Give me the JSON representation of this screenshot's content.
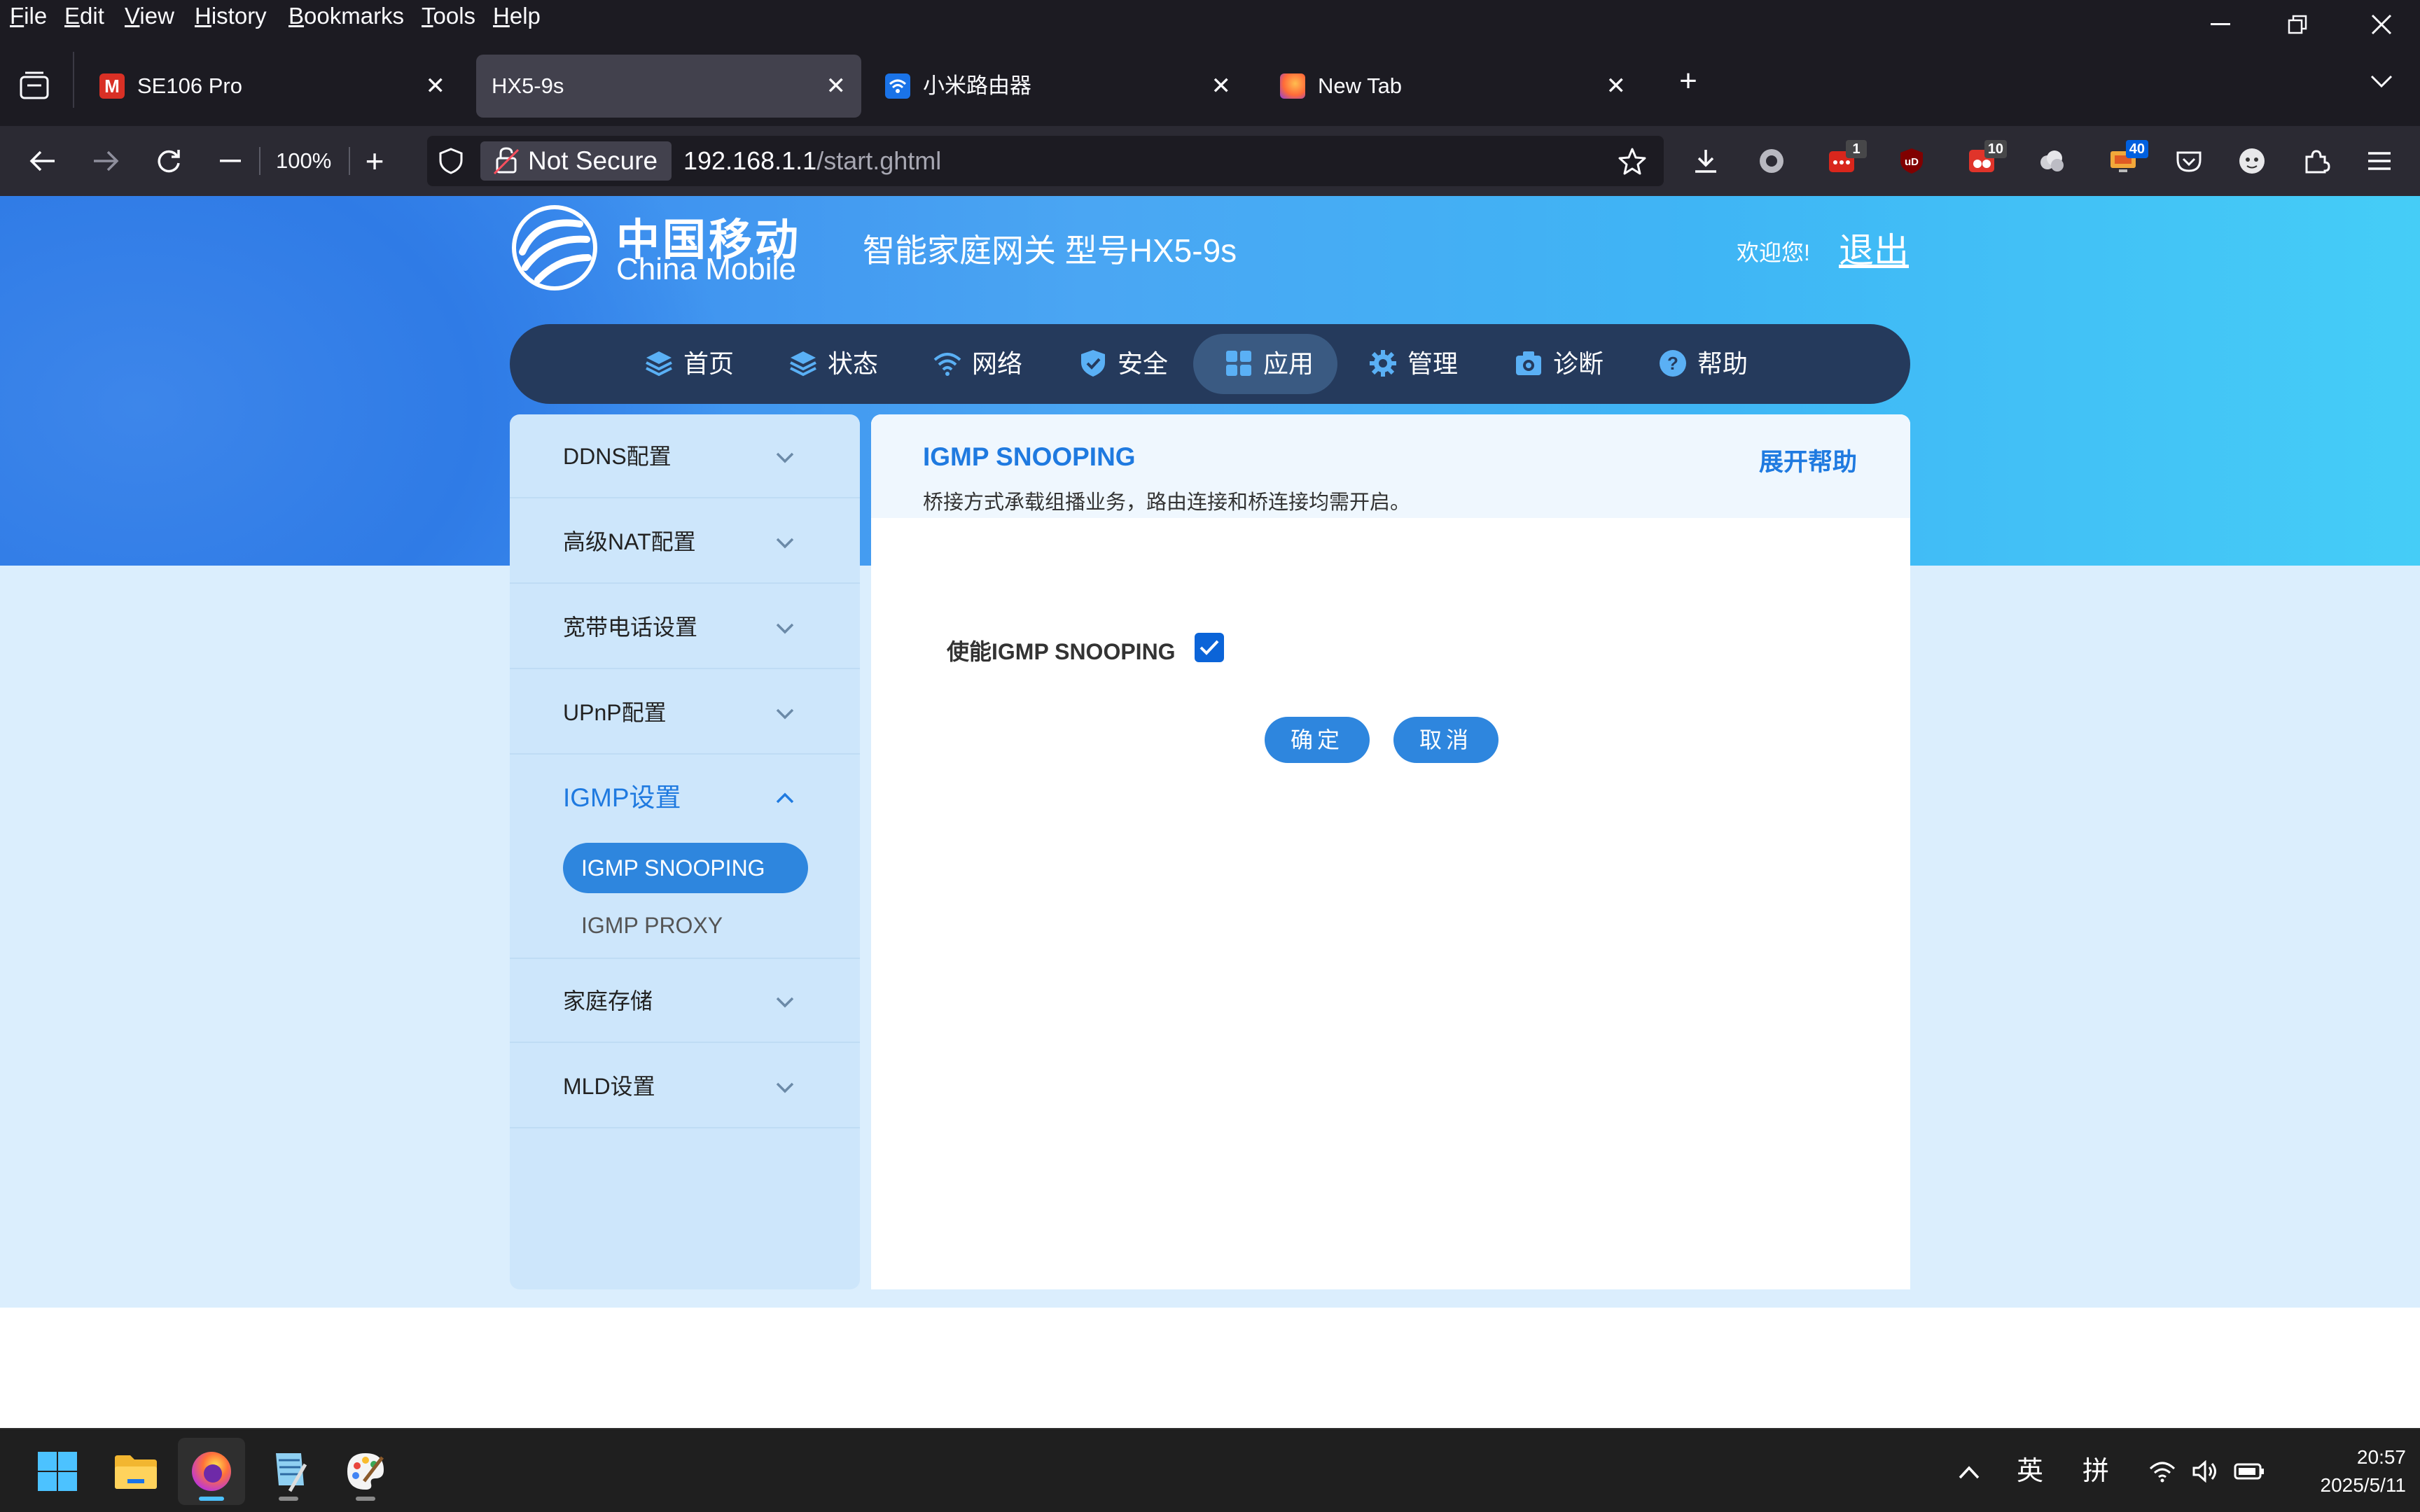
{
  "menubar": {
    "items": [
      {
        "u": "F",
        "rest": "ile"
      },
      {
        "u": "E",
        "rest": "dit"
      },
      {
        "u": "V",
        "rest": "iew"
      },
      {
        "u": "H",
        "rest": "istory"
      },
      {
        "u": "B",
        "rest": "ookmarks"
      },
      {
        "u": "T",
        "rest": "ools"
      },
      {
        "u": "H",
        "rest": "elp"
      }
    ]
  },
  "tabs": [
    {
      "title": "SE106 Pro",
      "icon": "mail-m-icon",
      "active": false
    },
    {
      "title": "HX5-9s",
      "icon": "",
      "active": true
    },
    {
      "title": "小米路由器",
      "icon": "wifi-icon",
      "active": false
    },
    {
      "title": "New Tab",
      "icon": "firefox-icon",
      "active": false
    }
  ],
  "navbar": {
    "zoom": "100%",
    "not_secure": "Not Secure",
    "url_host": "192.168.1.1",
    "url_path": "/start.ghtml",
    "badges": {
      "ext1": "1",
      "ext2": "10",
      "ext3": "40"
    }
  },
  "header": {
    "logo_cn": "中国移动",
    "logo_en": "China Mobile",
    "gateway_title": "智能家庭网关 型号HX5-9s",
    "welcome": "欢迎您!",
    "logout": "退出"
  },
  "mainnav": {
    "items": [
      {
        "label": "首页",
        "icon": "layers-icon"
      },
      {
        "label": "状态",
        "icon": "layers-icon"
      },
      {
        "label": "网络",
        "icon": "wifi-icon"
      },
      {
        "label": "安全",
        "icon": "shield-icon"
      },
      {
        "label": "应用",
        "icon": "grid-icon",
        "active": true
      },
      {
        "label": "管理",
        "icon": "gear-icon"
      },
      {
        "label": "诊断",
        "icon": "camera-icon"
      },
      {
        "label": "帮助",
        "icon": "help-icon"
      }
    ]
  },
  "sidebar": {
    "items": [
      {
        "label": "DDNS配置"
      },
      {
        "label": "高级NAT配置"
      },
      {
        "label": "宽带电话设置"
      },
      {
        "label": "UPnP配置"
      },
      {
        "label": "IGMP设置",
        "open": true
      },
      {
        "label": "家庭存储"
      },
      {
        "label": "MLD设置"
      }
    ],
    "sub_items": [
      "IGMP SNOOPING",
      "IGMP PROXY"
    ]
  },
  "content": {
    "title": "IGMP SNOOPING",
    "description": "桥接方式承载组播业务，路由连接和桥连接均需开启。",
    "help_link": "展开帮助",
    "field_label": "使能IGMP SNOOPING",
    "checkbox_checked": true,
    "confirm_label": "确定",
    "cancel_label": "取消"
  },
  "taskbar": {
    "ime_lang": "英",
    "ime_mode": "拼",
    "time": "20:57",
    "date": "2025/5/11"
  },
  "colors": {
    "accent": "#1f7ae0",
    "button": "#2e86de",
    "nav_bg": "#253a5c"
  }
}
